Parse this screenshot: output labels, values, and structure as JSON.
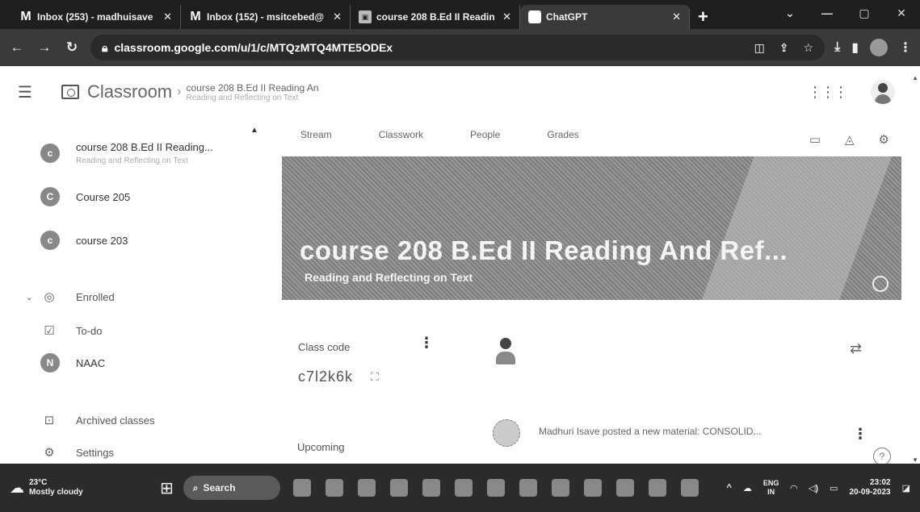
{
  "browser": {
    "tabs": [
      {
        "icon": "gmail-icon",
        "label": "Inbox (253) - madhuisave",
        "close": "✕"
      },
      {
        "icon": "gmail-icon",
        "label": "Inbox (152) - msitcebed@",
        "close": "✕"
      },
      {
        "icon": "classroom-icon",
        "label": "course 208 B.Ed II Readin",
        "close": "✕"
      },
      {
        "icon": "chatgpt-icon",
        "label": "ChatGPT",
        "close": "✕"
      }
    ],
    "new_tab": "+",
    "url": "classroom.google.com/u/1/c/MTQzMTQ4MTE5ODEx"
  },
  "header": {
    "app_name": "Classroom",
    "course_title": "course 208 B.Ed II Reading An",
    "course_sub": "Reading and Reflecting on Text"
  },
  "sidebar": {
    "classes": [
      {
        "initial": "c",
        "name": "course 208 B.Ed II Reading...",
        "sub": "Reading and Reflecting on Text"
      },
      {
        "initial": "C",
        "name": "Course 205",
        "sub": ""
      },
      {
        "initial": "c",
        "name": "course 203",
        "sub": ""
      }
    ],
    "enrolled": "Enrolled",
    "todo": "To-do",
    "naac": {
      "initial": "N",
      "name": "NAAC"
    },
    "archived": "Archived classes",
    "settings": "Settings"
  },
  "main": {
    "tabs": [
      "Stream",
      "Classwork",
      "People",
      "Grades"
    ],
    "banner_title": "course 208 B.Ed II Reading And Ref...",
    "banner_subtitle": "Reading and Reflecting on Text",
    "class_code_label": "Class code",
    "class_code": "c7l2k6k",
    "upcoming_label": "Upcoming",
    "material_post": "Madhuri Isave posted a new material: CONSOLID..."
  },
  "taskbar": {
    "temperature": "23°C",
    "weather": "Mostly cloudy",
    "search": "Search",
    "lang_top": "ENG",
    "lang_bottom": "IN",
    "time": "23:02",
    "date": "20-09-2023"
  }
}
